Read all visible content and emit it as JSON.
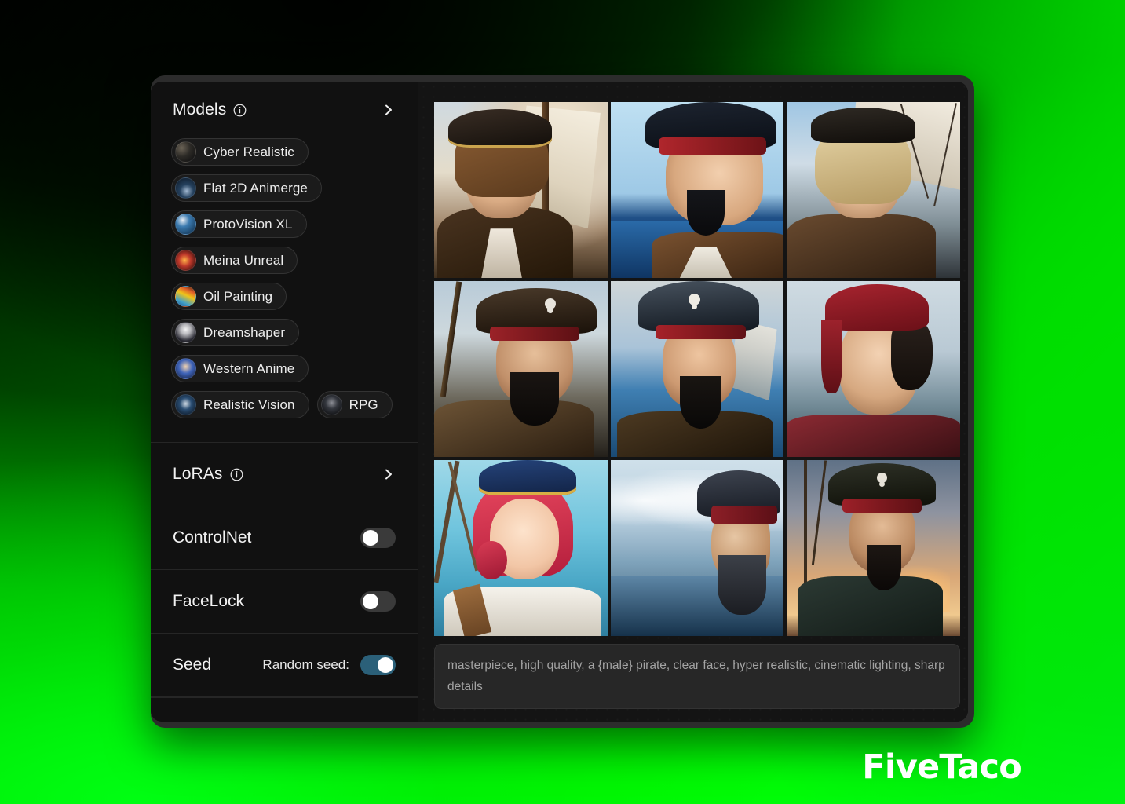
{
  "brand": {
    "logo": "FiveTaco"
  },
  "sidebar": {
    "models": {
      "title": "Models",
      "info_icon": "info-circle-icon",
      "expand_icon": "chevron-right-icon",
      "items": [
        {
          "label": "Cyber Realistic",
          "thumb": "t-cyber"
        },
        {
          "label": "Flat 2D Animerge",
          "thumb": "t-flat2d"
        },
        {
          "label": "ProtoVision XL",
          "thumb": "t-proto"
        },
        {
          "label": "Meina Unreal",
          "thumb": "t-meina"
        },
        {
          "label": "Oil Painting",
          "thumb": "t-oil"
        },
        {
          "label": "Dreamshaper",
          "thumb": "t-dream"
        },
        {
          "label": "Western Anime",
          "thumb": "t-western"
        },
        {
          "label": "Realistic Vision",
          "thumb": "t-realvis"
        },
        {
          "label": "RPG",
          "thumb": "t-rpg"
        }
      ]
    },
    "loras": {
      "title": "LoRAs",
      "info_icon": "info-circle-icon",
      "expand_icon": "chevron-right-icon"
    },
    "controlnet": {
      "label": "ControlNet",
      "enabled": false
    },
    "facelock": {
      "label": "FaceLock",
      "enabled": false
    },
    "seed": {
      "label": "Seed",
      "random_label": "Random seed:",
      "enabled": true
    }
  },
  "main": {
    "prompt": "masterpiece, high quality, a {male} pirate, clear face, hyper realistic, cinematic lighting, sharp details",
    "gallery": {
      "columns": 3,
      "images": [
        {
          "alt": "anime pirate with tricorn hat on tall ship",
          "art": "a1"
        },
        {
          "alt": "anime pirate profile with red headband at sea",
          "art": "a2"
        },
        {
          "alt": "blond pirate with ship rigging and sails",
          "art": "a3"
        },
        {
          "alt": "bearded pirate with skull tricorn hat",
          "art": "a4"
        },
        {
          "alt": "pirate captain facing forward with blue skull hat",
          "art": "a5"
        },
        {
          "alt": "young pirate with red bandana",
          "art": "a6"
        },
        {
          "alt": "red-haired female anime pirate on deck",
          "art": "a7"
        },
        {
          "alt": "painterly bearded captain over stormy sea",
          "art": "a8"
        },
        {
          "alt": "pirate on deck at sunset",
          "art": "a9"
        }
      ]
    }
  },
  "colors": {
    "background_green": "#00e800",
    "panel": "#111111",
    "main_panel": "#141414",
    "window_frame": "#2c2c2c",
    "toggle_on": "#2b6079",
    "toggle_off": "#3a3a3a",
    "text_primary": "#f2f2f2",
    "text_muted": "#a3a3a3"
  }
}
